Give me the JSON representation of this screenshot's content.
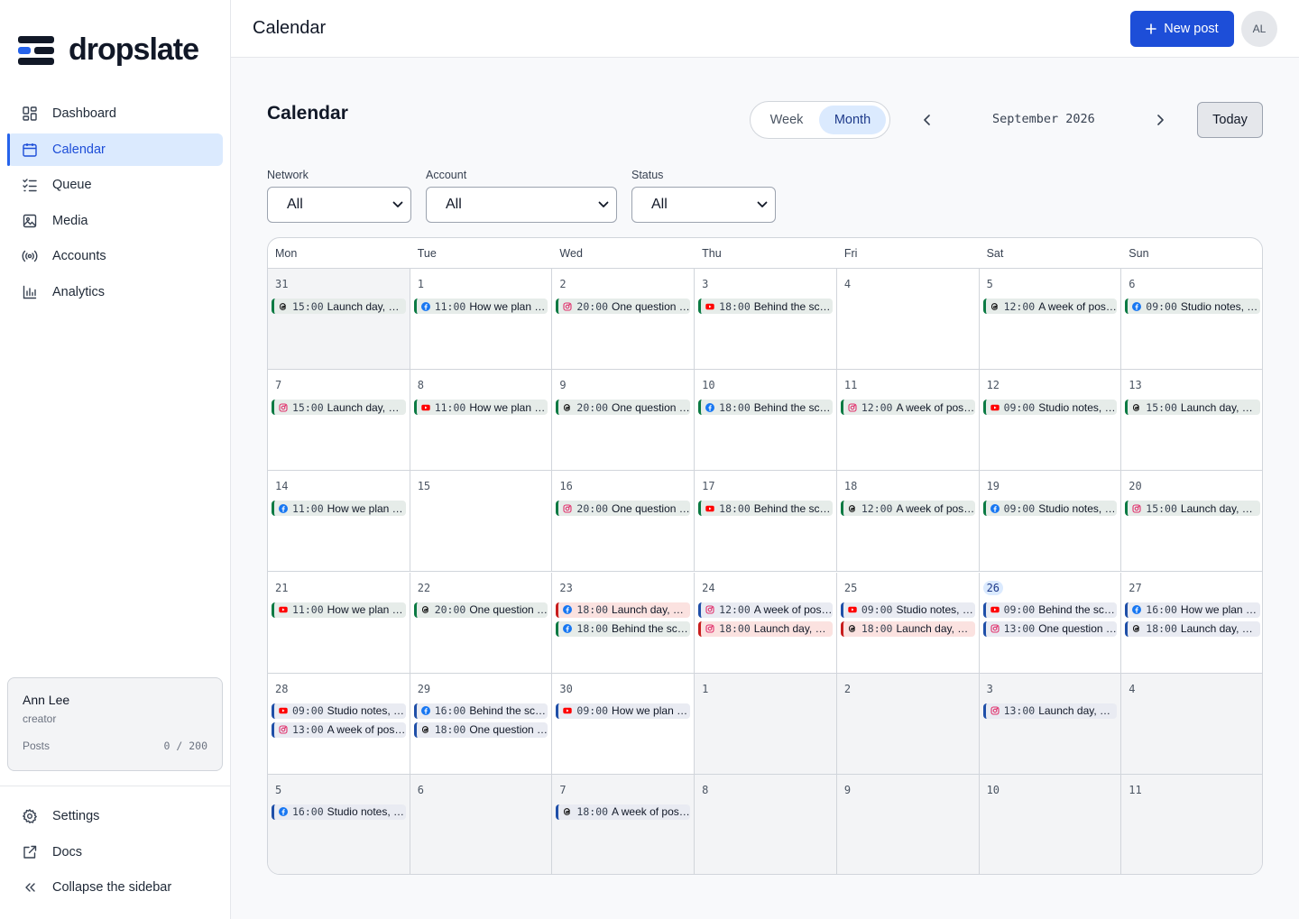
{
  "brand": {
    "name": "dropslate",
    "accent": "#2563eb"
  },
  "nav": [
    {
      "key": "dashboard",
      "label": "Dashboard",
      "icon": "dashboard-icon",
      "active": false
    },
    {
      "key": "calendar",
      "label": "Calendar",
      "icon": "calendar-icon",
      "active": true
    },
    {
      "key": "queue",
      "label": "Queue",
      "icon": "queue-icon",
      "active": false
    },
    {
      "key": "media",
      "label": "Media",
      "icon": "image-icon",
      "active": false
    },
    {
      "key": "accounts",
      "label": "Accounts",
      "icon": "broadcast-icon",
      "active": false
    },
    {
      "key": "analytics",
      "label": "Analytics",
      "icon": "bar-chart-icon",
      "active": false
    }
  ],
  "user": {
    "name": "Ann Lee",
    "role": "creator",
    "posts_label": "Posts",
    "posts_value": "0 / 200"
  },
  "bottom_nav": [
    {
      "key": "settings",
      "label": "Settings",
      "icon": "gear-icon"
    },
    {
      "key": "docs",
      "label": "Docs",
      "icon": "external-link-icon"
    },
    {
      "key": "collapse",
      "label": "Collapse the sidebar",
      "icon": "chevrons-left-icon"
    }
  ],
  "header": {
    "title": "Calendar",
    "new_post_label": "New post",
    "avatar_initials": "AL"
  },
  "main": {
    "title": "Calendar",
    "view_toggle": {
      "week": "Week",
      "month": "Month",
      "selected": "Month"
    },
    "month_label": "September 2026",
    "today_label": "Today"
  },
  "filters": [
    {
      "key": "network",
      "label": "Network",
      "value": "All"
    },
    {
      "key": "account",
      "label": "Account",
      "value": "All"
    },
    {
      "key": "status",
      "label": "Status",
      "value": "All"
    }
  ],
  "weekdays": [
    "Mon",
    "Tue",
    "Wed",
    "Thu",
    "Fri",
    "Sat",
    "Sun"
  ],
  "weeks": [
    [
      {
        "day": "31",
        "out": true,
        "events": [
          {
            "net": "threads",
            "time": "15:00",
            "title": "Launch day, what's new",
            "status": "published"
          }
        ]
      },
      {
        "day": "1",
        "events": [
          {
            "net": "facebook",
            "time": "11:00",
            "title": "How we plan our week",
            "status": "published"
          }
        ]
      },
      {
        "day": "2",
        "events": [
          {
            "net": "instagram",
            "time": "20:00",
            "title": "One question for you",
            "status": "published"
          }
        ]
      },
      {
        "day": "3",
        "events": [
          {
            "net": "youtube",
            "time": "18:00",
            "title": "Behind the scenes",
            "status": "published"
          }
        ]
      },
      {
        "day": "4",
        "events": []
      },
      {
        "day": "5",
        "events": [
          {
            "net": "threads",
            "time": "12:00",
            "title": "A week of posting",
            "status": "published"
          }
        ]
      },
      {
        "day": "6",
        "events": [
          {
            "net": "facebook",
            "time": "09:00",
            "title": "Studio notes, part one",
            "status": "published"
          }
        ]
      }
    ],
    [
      {
        "day": "7",
        "events": [
          {
            "net": "instagram",
            "time": "15:00",
            "title": "Launch day, what's new",
            "status": "published"
          }
        ]
      },
      {
        "day": "8",
        "events": [
          {
            "net": "youtube",
            "time": "11:00",
            "title": "How we plan our week",
            "status": "published"
          }
        ]
      },
      {
        "day": "9",
        "events": [
          {
            "net": "threads",
            "time": "20:00",
            "title": "One question for you",
            "status": "published"
          }
        ]
      },
      {
        "day": "10",
        "events": [
          {
            "net": "facebook",
            "time": "18:00",
            "title": "Behind the scenes",
            "status": "published"
          }
        ]
      },
      {
        "day": "11",
        "events": [
          {
            "net": "instagram",
            "time": "12:00",
            "title": "A week of posting",
            "status": "published"
          }
        ]
      },
      {
        "day": "12",
        "events": [
          {
            "net": "youtube",
            "time": "09:00",
            "title": "Studio notes, part one",
            "status": "published"
          }
        ]
      },
      {
        "day": "13",
        "events": [
          {
            "net": "threads",
            "time": "15:00",
            "title": "Launch day, what's new",
            "status": "published"
          }
        ]
      }
    ],
    [
      {
        "day": "14",
        "events": [
          {
            "net": "facebook",
            "time": "11:00",
            "title": "How we plan our week",
            "status": "published"
          }
        ]
      },
      {
        "day": "15",
        "events": []
      },
      {
        "day": "16",
        "events": [
          {
            "net": "instagram",
            "time": "20:00",
            "title": "One question for you",
            "status": "published"
          }
        ]
      },
      {
        "day": "17",
        "events": [
          {
            "net": "youtube",
            "time": "18:00",
            "title": "Behind the scenes",
            "status": "published"
          }
        ]
      },
      {
        "day": "18",
        "events": [
          {
            "net": "threads",
            "time": "12:00",
            "title": "A week of posting",
            "status": "published"
          }
        ]
      },
      {
        "day": "19",
        "events": [
          {
            "net": "facebook",
            "time": "09:00",
            "title": "Studio notes, part one",
            "status": "published"
          }
        ]
      },
      {
        "day": "20",
        "events": [
          {
            "net": "instagram",
            "time": "15:00",
            "title": "Launch day, what's new",
            "status": "published"
          }
        ]
      }
    ],
    [
      {
        "day": "21",
        "events": [
          {
            "net": "youtube",
            "time": "11:00",
            "title": "How we plan our week",
            "status": "published"
          }
        ]
      },
      {
        "day": "22",
        "events": [
          {
            "net": "threads",
            "time": "20:00",
            "title": "One question for you",
            "status": "published"
          }
        ]
      },
      {
        "day": "23",
        "events": [
          {
            "net": "facebook",
            "time": "18:00",
            "title": "Launch day, what's new",
            "status": "failed"
          },
          {
            "net": "facebook",
            "time": "18:00",
            "title": "Behind the scenes",
            "status": "published"
          }
        ]
      },
      {
        "day": "24",
        "events": [
          {
            "net": "instagram",
            "time": "12:00",
            "title": "A week of posting",
            "status": "scheduled"
          },
          {
            "net": "instagram",
            "time": "18:00",
            "title": "Launch day, what's new",
            "status": "failed"
          }
        ]
      },
      {
        "day": "25",
        "events": [
          {
            "net": "youtube",
            "time": "09:00",
            "title": "Studio notes, part one",
            "status": "scheduled"
          },
          {
            "net": "threads",
            "time": "18:00",
            "title": "Launch day, what's new",
            "status": "failed"
          }
        ]
      },
      {
        "day": "26",
        "today": true,
        "events": [
          {
            "net": "youtube",
            "time": "09:00",
            "title": "Behind the scenes",
            "status": "scheduled"
          },
          {
            "net": "instagram",
            "time": "13:00",
            "title": "One question for you",
            "status": "scheduled"
          }
        ]
      },
      {
        "day": "27",
        "events": [
          {
            "net": "facebook",
            "time": "16:00",
            "title": "How we plan our week",
            "status": "scheduled"
          },
          {
            "net": "threads",
            "time": "18:00",
            "title": "Launch day, what's new",
            "status": "scheduled"
          }
        ]
      }
    ],
    [
      {
        "day": "28",
        "events": [
          {
            "net": "youtube",
            "time": "09:00",
            "title": "Studio notes, part one",
            "status": "scheduled"
          },
          {
            "net": "instagram",
            "time": "13:00",
            "title": "A week of posting",
            "status": "scheduled"
          }
        ]
      },
      {
        "day": "29",
        "events": [
          {
            "net": "facebook",
            "time": "16:00",
            "title": "Behind the scenes",
            "status": "scheduled"
          },
          {
            "net": "threads",
            "time": "18:00",
            "title": "One question for you",
            "status": "scheduled"
          }
        ]
      },
      {
        "day": "30",
        "events": [
          {
            "net": "youtube",
            "time": "09:00",
            "title": "How we plan our week",
            "status": "scheduled"
          }
        ]
      },
      {
        "day": "1",
        "out": true,
        "events": []
      },
      {
        "day": "2",
        "out": true,
        "events": []
      },
      {
        "day": "3",
        "out": true,
        "events": [
          {
            "net": "instagram",
            "time": "13:00",
            "title": "Launch day, what's new",
            "status": "scheduled"
          }
        ]
      },
      {
        "day": "4",
        "out": true,
        "events": []
      }
    ],
    [
      {
        "day": "5",
        "out": true,
        "events": [
          {
            "net": "facebook",
            "time": "16:00",
            "title": "Studio notes, part one",
            "status": "scheduled"
          }
        ]
      },
      {
        "day": "6",
        "out": true,
        "events": []
      },
      {
        "day": "7",
        "out": true,
        "events": [
          {
            "net": "threads",
            "time": "18:00",
            "title": "A week of posting",
            "status": "scheduled"
          }
        ]
      },
      {
        "day": "8",
        "out": true,
        "events": []
      },
      {
        "day": "9",
        "out": true,
        "events": []
      },
      {
        "day": "10",
        "out": true,
        "events": []
      },
      {
        "day": "11",
        "out": true,
        "events": []
      }
    ]
  ],
  "network_colors": {
    "facebook": "#1877f2",
    "instagram": "#e1306c",
    "youtube": "#ff0000",
    "threads": "#111111"
  },
  "status_colors": {
    "scheduled": "#1f4fa8",
    "published": "#0b7a43",
    "failed": "#c81e1e"
  }
}
